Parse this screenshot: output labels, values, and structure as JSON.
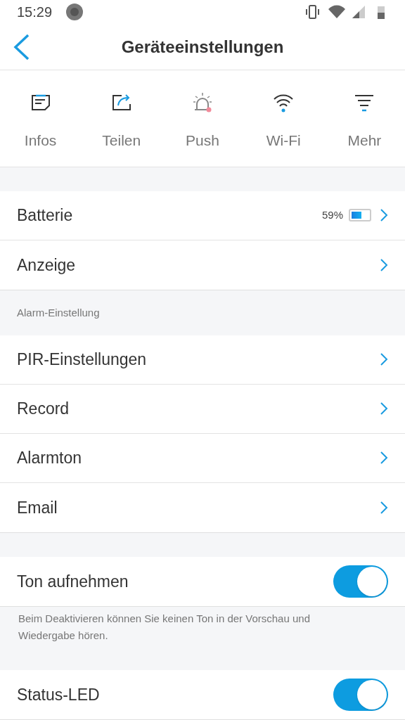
{
  "status_bar": {
    "time": "15:29"
  },
  "header": {
    "title": "Geräteeinstellungen"
  },
  "quick_actions": [
    {
      "kind": "info",
      "label": "Infos"
    },
    {
      "kind": "share",
      "label": "Teilen"
    },
    {
      "kind": "push",
      "label": "Push"
    },
    {
      "kind": "wifi",
      "label": "Wi-Fi"
    },
    {
      "kind": "more",
      "label": "Mehr"
    }
  ],
  "sections": [
    {
      "items": [
        {
          "kind": "battery",
          "label": "Batterie",
          "reading": "59%"
        },
        {
          "kind": "link",
          "label": "Anzeige"
        }
      ]
    },
    {
      "title": "Alarm-Einstellung",
      "items": [
        {
          "kind": "link",
          "label": "PIR-Einstellungen"
        },
        {
          "kind": "link",
          "label": "Record"
        },
        {
          "kind": "link",
          "label": "Alarmton"
        },
        {
          "kind": "link",
          "label": "Email"
        }
      ]
    },
    {
      "items": [
        {
          "kind": "toggle",
          "label": "Ton aufnehmen",
          "on": true
        }
      ],
      "note": "Beim Deaktivieren können Sie keinen Ton in der Vorschau und Wiedergabe hören."
    },
    {
      "items": [
        {
          "kind": "toggle",
          "label": "Status-LED",
          "on": true
        }
      ]
    }
  ]
}
